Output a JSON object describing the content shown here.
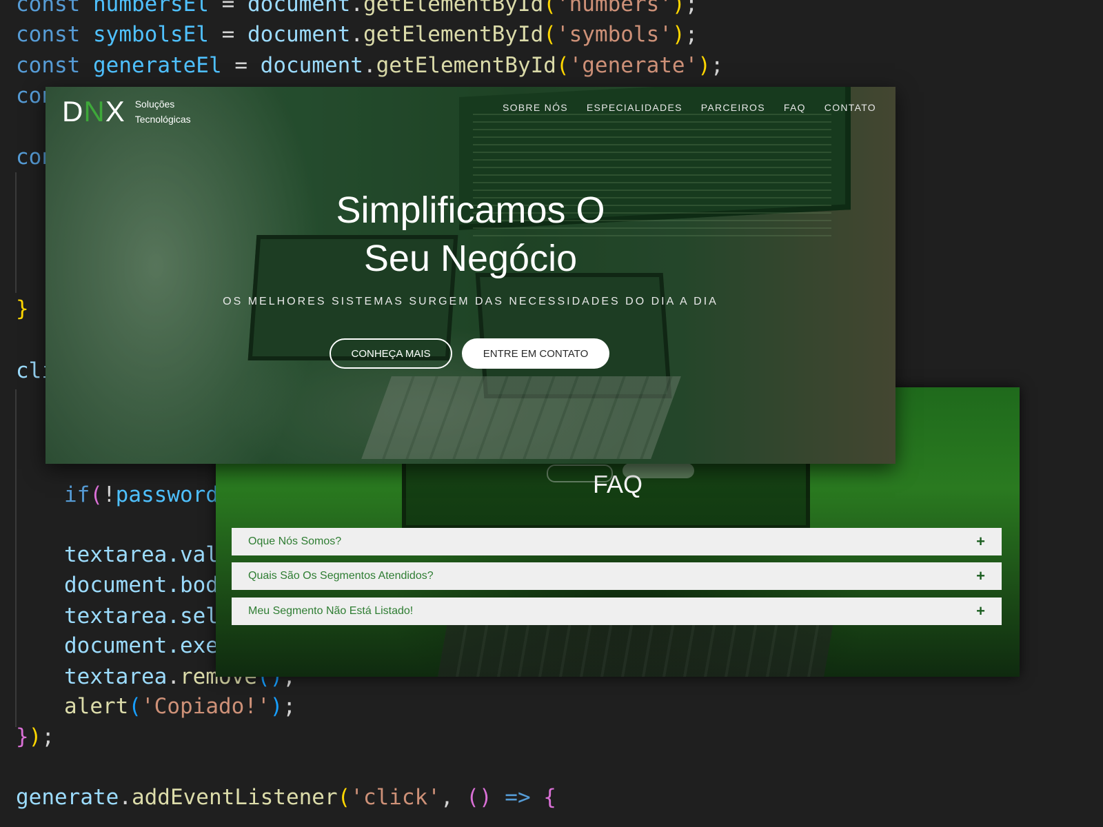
{
  "code_lines": [
    "const numbersEl = document.getElementById('numbers');",
    "const symbolsEl = document.getElementById('symbols');",
    "const generateEl = document.getElementById('generate');",
    "con",
    "con",
    "}",
    "cli",
    "if(!password",
    "textarea.val",
    "document.bod",
    "textarea.sel",
    "document.exe",
    "textarea.remove();",
    "alert('Copiado!');",
    "});",
    "generate.addEventListener('click', () => {"
  ],
  "hero": {
    "logo_d": "D",
    "logo_n": "N",
    "logo_x": "X",
    "logo_sub_line1": "Soluções",
    "logo_sub_line2": "Tecnológicas",
    "nav": [
      "SOBRE NÓS",
      "ESPECIALIDADES",
      "PARCEIROS",
      "FAQ",
      "CONTATO"
    ],
    "title_line1": "Simplificamos O",
    "title_line2": "Seu Negócio",
    "subtitle": "OS MELHORES SISTEMAS SURGEM DAS NECESSIDADES DO DIA A DIA",
    "btn_more": "CONHEÇA MAIS",
    "btn_contact": "ENTRE EM CONTATO"
  },
  "faq": {
    "title": "FAQ",
    "items": [
      {
        "question": "Oque Nós Somos?",
        "icon": "+"
      },
      {
        "question": "Quais São Os Segmentos Atendidos?",
        "icon": "+"
      },
      {
        "question": "Meu Segmento Não Está Listado!",
        "icon": "+"
      }
    ]
  },
  "colors": {
    "editor_bg": "#1f1f1f",
    "brand_green": "#3ea83a",
    "faq_text": "#2e7d32"
  }
}
